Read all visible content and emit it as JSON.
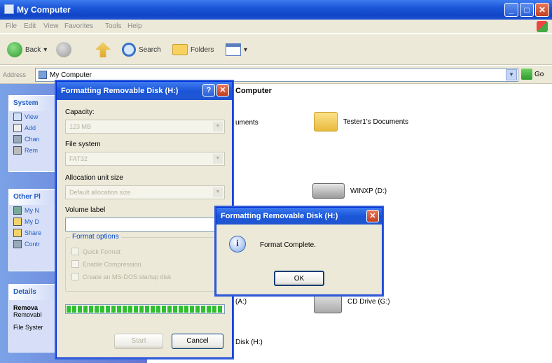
{
  "window": {
    "title": "My Computer"
  },
  "menu": [
    "File",
    "Edit",
    "View",
    "Favorites",
    "Tools",
    "Help"
  ],
  "toolbar": {
    "back": "Back",
    "search": "Search",
    "folders": "Folders"
  },
  "address": {
    "label": "Address",
    "value": "My Computer",
    "go": "Go"
  },
  "side_panels": {
    "system": {
      "title": "System",
      "items": [
        "View",
        "Add",
        "Chan",
        "Rem"
      ]
    },
    "other": {
      "title": "Other Pl",
      "items": [
        "My N",
        "My D",
        "Share",
        "Contr"
      ]
    },
    "details": {
      "title": "Details",
      "name": "Remova",
      "type": "Removabl",
      "fs": "File Syster"
    }
  },
  "content": {
    "header": "Computer",
    "items": {
      "shared_docs": "uments",
      "tester_docs": "Tester1's Documents",
      "drive_c": "",
      "winxp": "WINXP (D:)",
      "floppy": "(A:)",
      "cd": "CD Drive (G:)",
      "removable": "Disk (H:)"
    }
  },
  "format_dialog": {
    "title": "Formatting Removable Disk (H:)",
    "capacity_label": "Capacity:",
    "capacity_value": "123 MB",
    "fs_label": "File system",
    "fs_value": "FAT32",
    "alloc_label": "Allocation unit size",
    "alloc_value": "Default allocation size",
    "volume_label": "Volume label",
    "volume_value": "",
    "options_title": "Format options",
    "options": [
      "Quick Format",
      "Enable Compression",
      "Create an MS-DOS startup disk"
    ],
    "progress": 1.0,
    "start": "Start",
    "cancel": "Cancel"
  },
  "complete_dialog": {
    "title": "Formatting Removable Disk (H:)",
    "message": "Format Complete.",
    "ok": "OK"
  }
}
